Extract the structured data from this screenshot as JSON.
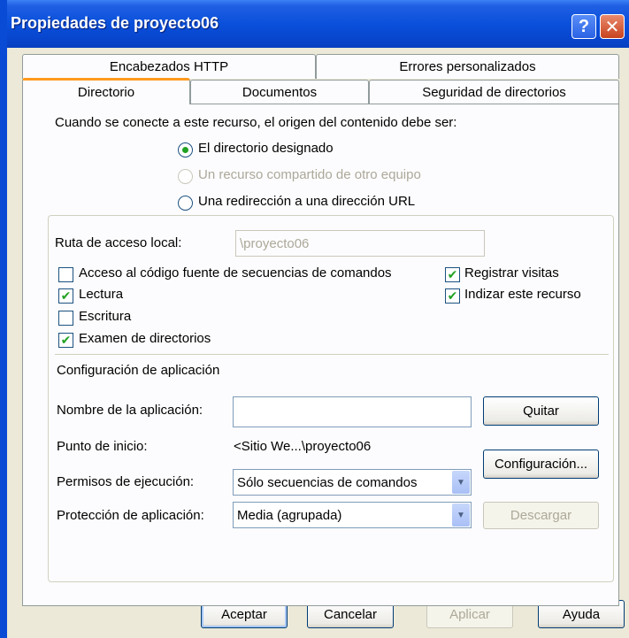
{
  "window": {
    "title": "Propiedades de proyecto06",
    "help_glyph": "?",
    "close_glyph": "✕"
  },
  "tabs": {
    "row1": [
      "Encabezados HTTP",
      "Errores personalizados"
    ],
    "row2": [
      "Directorio",
      "Documentos",
      "Seguridad de directorios"
    ],
    "active": "Directorio"
  },
  "content": {
    "intro": "Cuando se conecte a este recurso, el origen del contenido debe ser:",
    "source_options": [
      {
        "label": "El directorio designado",
        "checked": true,
        "enabled": true
      },
      {
        "label": "Un recurso compartido de otro equipo",
        "checked": false,
        "enabled": false
      },
      {
        "label": "Una redirección a una dirección URL",
        "checked": false,
        "enabled": true
      }
    ],
    "local_path_label": "Ruta de acceso local:",
    "local_path_value": "\\proyecto06",
    "checkboxes_left": [
      {
        "label": "Acceso al código fuente de secuencias de comandos",
        "checked": false
      },
      {
        "label": "Lectura",
        "checked": true
      },
      {
        "label": "Escritura",
        "checked": false
      },
      {
        "label": "Examen de directorios",
        "checked": true
      }
    ],
    "checkboxes_right": [
      {
        "label": "Registrar visitas",
        "checked": true
      },
      {
        "label": "Indizar este recurso",
        "checked": true
      }
    ],
    "app_config_heading": "Configuración de aplicación",
    "app_name_label": "Nombre de la aplicación:",
    "app_name_value": "",
    "remove_button": "Quitar",
    "start_point_label": "Punto de inicio:",
    "start_point_value": "<Sitio We...\\proyecto06",
    "config_button": "Configuración...",
    "exec_perms_label": "Permisos de ejecución:",
    "exec_perms_value": "Sólo secuencias de comandos",
    "app_protection_label": "Protección de aplicación:",
    "app_protection_value": "Media (agrupada)",
    "unload_button": "Descargar",
    "check_glyph": "✔",
    "dropdown_glyph": "▼"
  },
  "footer": {
    "ok": "Aceptar",
    "cancel": "Cancelar",
    "apply": "Aplicar",
    "help": "Ayuda"
  },
  "colors": {
    "titlebar": "#0A50DB",
    "dialog_bg": "#ECE9D8",
    "panel_bg": "#FCFCFE",
    "active_tab_accent": "#FF9A1E",
    "check_green": "#21A121",
    "disabled_text": "#ACA899"
  }
}
